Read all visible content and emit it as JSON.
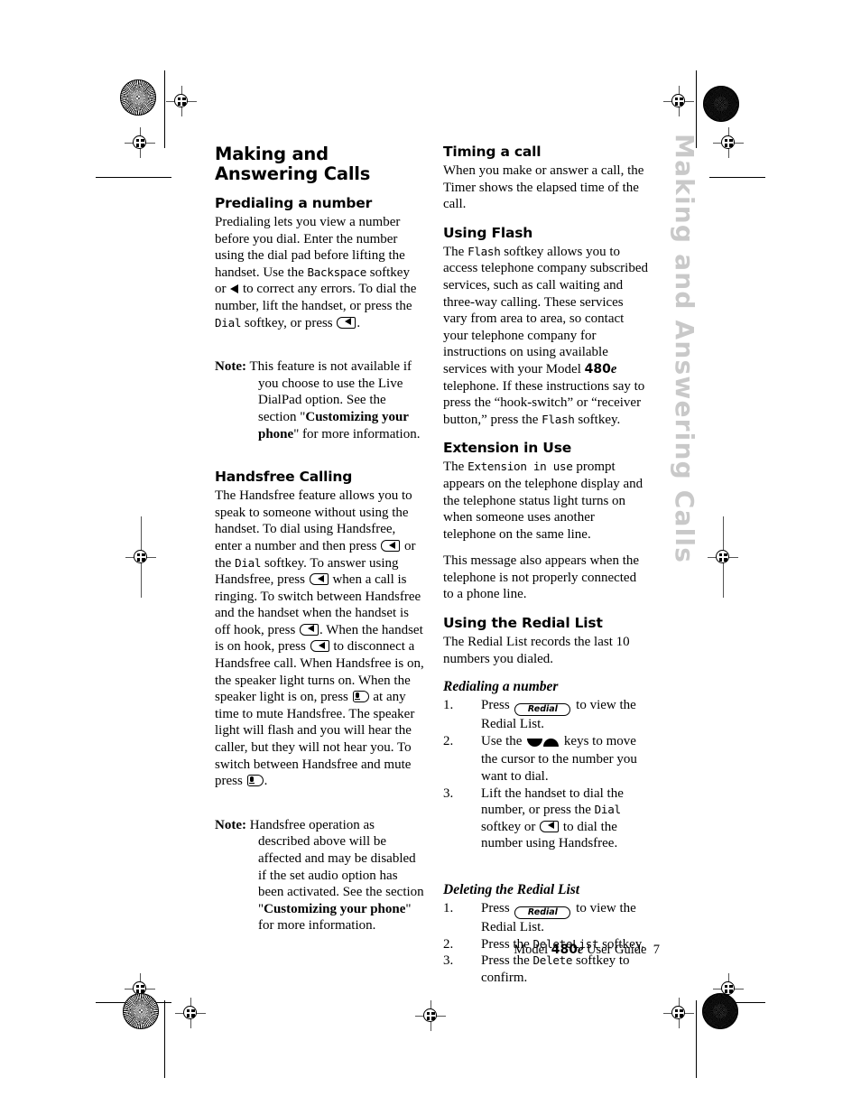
{
  "running_head": "Making and Answering Calls",
  "left_column": {
    "title": "Making and Answering Calls",
    "sections": [
      {
        "heading": "Predialing a number",
        "body_1": "Predialing lets you view a number before you dial. Enter the number using the dial pad before lifting the handset. Use the ",
        "mono_backspace": "Backspace",
        "body_2": " softkey or ",
        "body_3": " to correct any errors. To dial the number, lift the handset, or press the ",
        "mono_dial": "Dial",
        "body_4": " softkey, or press ",
        "body_5": "."
      }
    ],
    "note_1": {
      "label": "Note:",
      "text_1": "This feature is not available if you choose to use the Live DialPad option.  See the section \"",
      "bold": "Customizing your phone",
      "text_2": "\" for more information."
    },
    "handsfree": {
      "heading": "Handsfree Calling",
      "t1": "The Handsfree feature allows you to speak to someone without using the handset. To dial using Handsfree, enter a number and then press ",
      "t2": " or the ",
      "mono_dial": "Dial",
      "t3": " softkey. To answer using Handsfree, press ",
      "t4": " when a call is ringing.  To switch between Handsfree and the handset when the handset is off hook, press ",
      "t5": ". When the handset is on hook, press ",
      "t6": " to disconnect a Handsfree call. When Handsfree is on, the speaker light turns on. When the speaker light is on, press ",
      "t7": " at any time to mute Handsfree. The speaker light will flash and you will hear the caller, but they will not hear you. To switch between Handsfree and mute press ",
      "t8": "."
    },
    "note_2": {
      "label": "Note:",
      "text_1": "Handsfree operation as described above will be affected and may be disabled if the set audio option has been activated.  See the section \"",
      "bold": "Customizing your phone",
      "text_2": "\" for more information."
    }
  },
  "right_column": {
    "timing": {
      "heading": "Timing a call",
      "body": "When you make or answer a call, the Timer shows the elapsed time of the call."
    },
    "flash": {
      "heading": "Using Flash",
      "t1": "The ",
      "mono_flash_1": "Flash",
      "t2": " softkey allows you to access telephone company subscribed services, such as call waiting and three-way calling. These services vary from area to area, so contact your telephone company for instructions on using available services with your Model ",
      "model_num": "480",
      "model_e": "e",
      "t3": " telephone. If these instructions say to press the “hook-switch” or “receiver button,” press the ",
      "mono_flash_2": "Flash",
      "t4": " softkey."
    },
    "extension": {
      "heading": "Extension in Use",
      "t1": "The ",
      "mono_prompt": "Extension in use",
      "t2": " prompt appears on the telephone display and the telephone status light turns on when someone uses another telephone on the same line.",
      "t3": "This message also appears when the telephone is not properly connected to a phone line."
    },
    "redial": {
      "heading": "Using the Redial List",
      "intro": "The Redial List records the last 10 numbers you dialed.",
      "sub_redialing": "Redialing a number",
      "steps_redialing": [
        {
          "num": "1.",
          "t1": "Press ",
          "pill": "Redial",
          "t2": " to view the Redial List."
        },
        {
          "num": "2.",
          "t1": "Use the ",
          "t2": " keys to move the cursor to the number you want to dial."
        },
        {
          "num": "3.",
          "t1": "Lift the handset to dial the number, or press the ",
          "mono_dial": "Dial",
          "t2": " softkey or ",
          "t3": " to dial the number using Handsfree."
        }
      ],
      "sub_deleting": "Deleting the Redial List",
      "steps_deleting": [
        {
          "num": "1.",
          "t1": "Press ",
          "pill": "Redial",
          "t2": " to view the Redial List."
        },
        {
          "num": "2.",
          "t1": "Press the ",
          "mono": "DeleteList",
          "t2": " softkey."
        },
        {
          "num": "3.",
          "t1": "Press the ",
          "mono": "Delete",
          "t2": " softkey to confirm."
        }
      ]
    }
  },
  "footer": {
    "model_word": "Model ",
    "model_num": "480",
    "model_e": "e",
    "guide": " User Guide",
    "page_number": "7"
  },
  "colors": {
    "text": "#000000",
    "running_head": "#c9c9c9",
    "page_background": "#ffffff"
  }
}
